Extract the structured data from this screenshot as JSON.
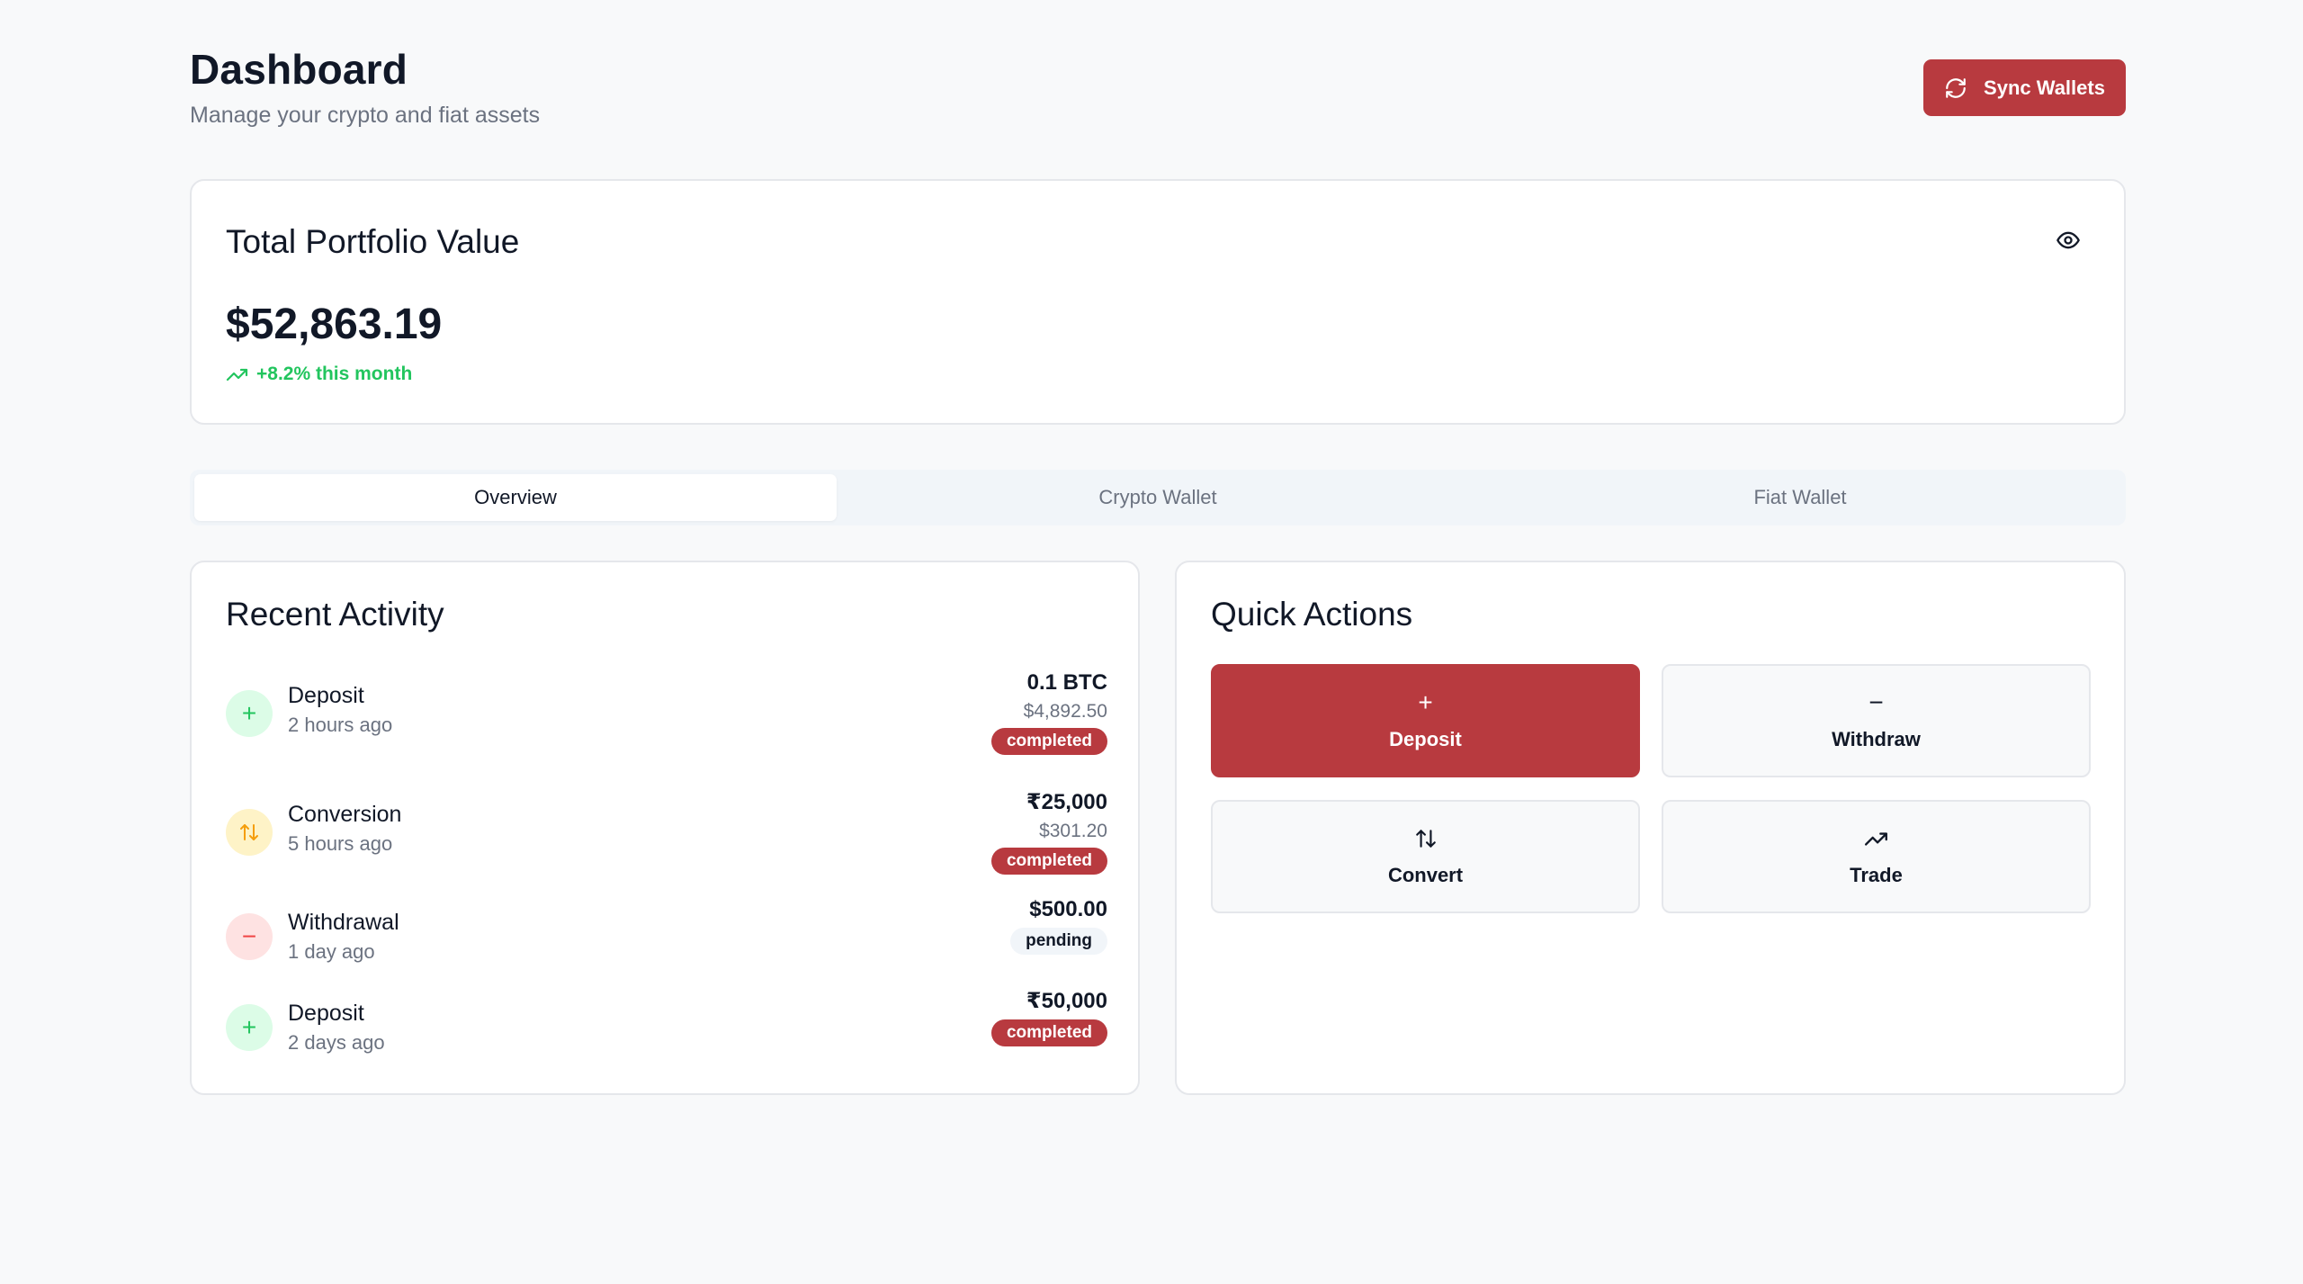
{
  "header": {
    "title": "Dashboard",
    "subtitle": "Manage your crypto and fiat assets",
    "sync_label": "Sync Wallets"
  },
  "portfolio": {
    "title": "Total Portfolio Value",
    "value": "$52,863.19",
    "change": "+8.2% this month"
  },
  "tabs": [
    {
      "label": "Overview",
      "active": true
    },
    {
      "label": "Crypto Wallet",
      "active": false
    },
    {
      "label": "Fiat Wallet",
      "active": false
    }
  ],
  "activity": {
    "title": "Recent Activity",
    "items": [
      {
        "type": "Deposit",
        "time": "2 hours ago",
        "amount": "0.1 BTC",
        "fiat": "$4,892.50",
        "status": "completed",
        "icon": "plus-icon"
      },
      {
        "type": "Conversion",
        "time": "5 hours ago",
        "amount": "₹25,000",
        "fiat": "$301.20",
        "status": "completed",
        "icon": "swap-icon"
      },
      {
        "type": "Withdrawal",
        "time": "1 day ago",
        "amount": "$500.00",
        "fiat": "",
        "status": "pending",
        "icon": "minus-icon"
      },
      {
        "type": "Deposit",
        "time": "2 days ago",
        "amount": "₹50,000",
        "fiat": "",
        "status": "completed",
        "icon": "plus-icon"
      }
    ]
  },
  "quick_actions": {
    "title": "Quick Actions",
    "buttons": [
      {
        "label": "Deposit",
        "icon": "plus-icon"
      },
      {
        "label": "Withdraw",
        "icon": "minus-icon"
      },
      {
        "label": "Convert",
        "icon": "swap-icon"
      },
      {
        "label": "Trade",
        "icon": "trending-up-icon"
      }
    ]
  },
  "colors": {
    "primary": "#b83a3f",
    "positive": "#22c55e",
    "background": "#f8f9fa"
  }
}
